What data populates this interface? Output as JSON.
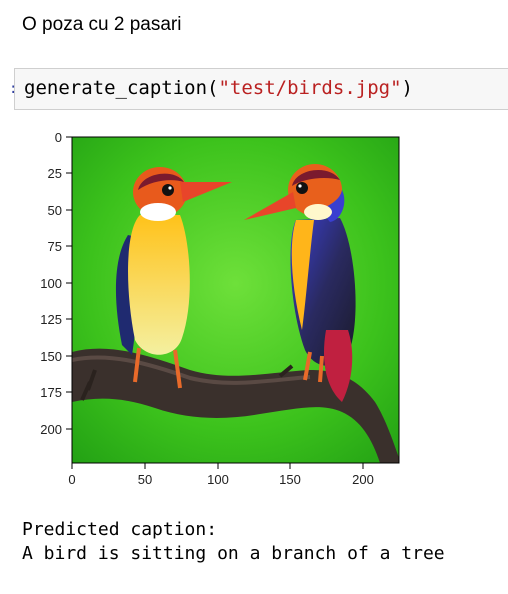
{
  "markdown": {
    "text": "O poza cu 2 pasari"
  },
  "code_cell": {
    "func": "generate_caption",
    "open": "(",
    "arg": "\"test/birds.jpg\"",
    "close": ")"
  },
  "figure": {
    "y_ticks": [
      "0",
      "25",
      "50",
      "75",
      "100",
      "125",
      "150",
      "175",
      "200"
    ],
    "x_ticks": [
      "0",
      "50",
      "100",
      "150",
      "200"
    ],
    "image_content": "two-kingfishers-on-branch"
  },
  "output": {
    "label": "Predicted caption:",
    "caption": "A bird is sitting on a branch of a tree"
  }
}
